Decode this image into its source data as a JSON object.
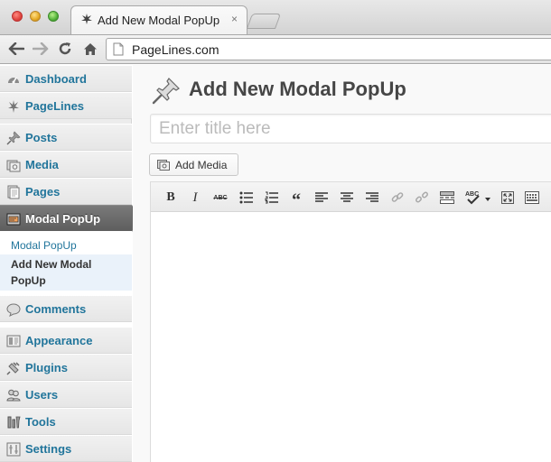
{
  "browser": {
    "tab_title": "Add New Modal PopUp",
    "tab_close": "×",
    "url": "PageLines.com"
  },
  "sidebar": {
    "items": [
      {
        "label": "Dashboard",
        "icon": "dashboard-icon"
      },
      {
        "label": "PageLines",
        "icon": "pagelines-icon"
      },
      {
        "label": "Posts",
        "icon": "pushpin-icon"
      },
      {
        "label": "Media",
        "icon": "media-icon"
      },
      {
        "label": "Pages",
        "icon": "pages-icon"
      },
      {
        "label": "Modal PopUp",
        "icon": "modal-icon",
        "current": true
      },
      {
        "label": "Comments",
        "icon": "comment-icon"
      },
      {
        "label": "Appearance",
        "icon": "appearance-icon"
      },
      {
        "label": "Plugins",
        "icon": "plugin-icon"
      },
      {
        "label": "Users",
        "icon": "users-icon"
      },
      {
        "label": "Tools",
        "icon": "tools-icon"
      },
      {
        "label": "Settings",
        "icon": "settings-icon"
      }
    ],
    "submenu": [
      {
        "label": "Modal PopUp"
      },
      {
        "label": "Add New Modal PopUp",
        "current": true
      }
    ]
  },
  "main": {
    "page_title": "Add New Modal PopUp",
    "title_placeholder": "Enter title here",
    "add_media_label": "Add Media",
    "editor_toolbar": [
      "bold-icon",
      "italic-icon",
      "strikethrough-icon",
      "bullet-list-icon",
      "numbered-list-icon",
      "blockquote-icon",
      "align-left-icon",
      "align-center-icon",
      "align-right-icon",
      "link-icon",
      "unlink-icon",
      "more-tag-icon",
      "spellcheck-icon",
      "fullscreen-icon",
      "kitchen-sink-icon"
    ],
    "toolbar_text": {
      "bold": "B",
      "italic": "I",
      "strike": "ABC",
      "quote": "“"
    }
  },
  "colors": {
    "link": "#21759b",
    "current_menu_bg": "#6b6b6b",
    "submenu_current_bg": "#eaf2fa"
  }
}
